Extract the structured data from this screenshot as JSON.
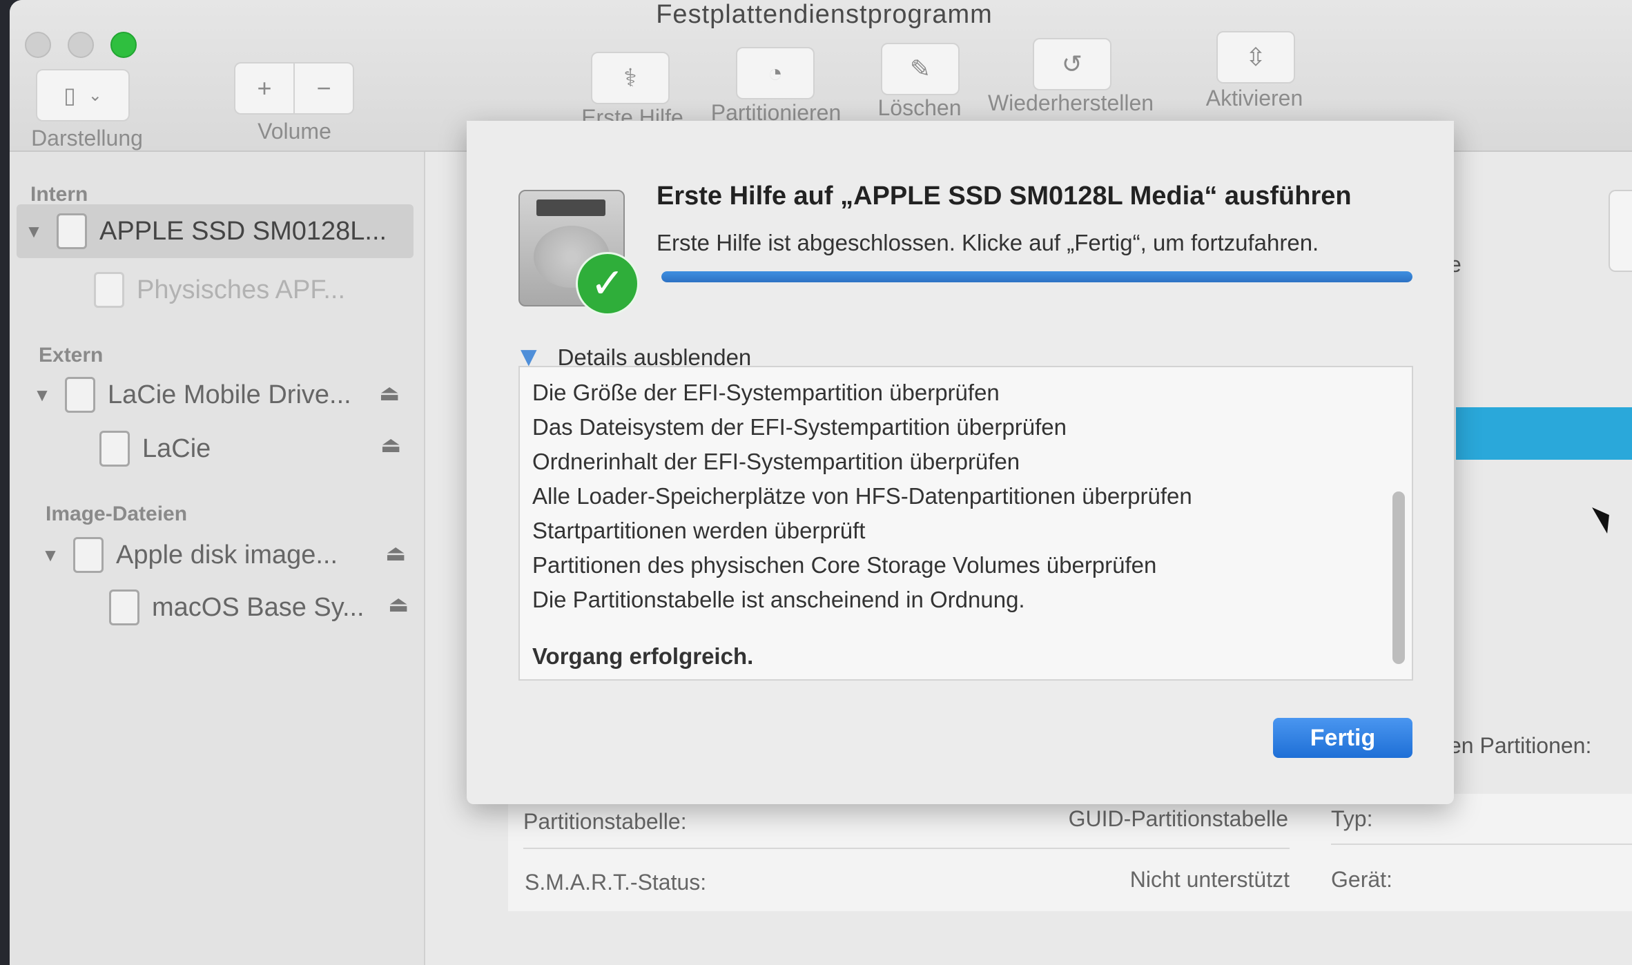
{
  "window": {
    "title": "Festplattendienstprogramm"
  },
  "toolbar": {
    "view_label": "Darstellung",
    "volume_label": "Volume",
    "add_symbol": "+",
    "remove_symbol": "−",
    "buttons": [
      {
        "label": "Erste Hilfe",
        "icon": "stethoscope-icon"
      },
      {
        "label": "Partitionieren",
        "icon": "pie-chart-icon"
      },
      {
        "label": "Löschen",
        "icon": "erase-icon"
      },
      {
        "label": "Wiederherstellen",
        "icon": "restore-icon"
      },
      {
        "label": "Aktivieren",
        "icon": "mount-icon"
      }
    ]
  },
  "sidebar": {
    "sections": [
      {
        "title": "Intern"
      },
      {
        "title": "Extern"
      },
      {
        "title": "Image-Dateien"
      }
    ],
    "items": [
      {
        "label": "APPLE SSD SM0128L...",
        "selected": true
      },
      {
        "label": "Physisches APF..."
      },
      {
        "label": "LaCie Mobile Drive..."
      },
      {
        "label": "LaCie"
      },
      {
        "label": "Apple disk image..."
      },
      {
        "label": "macOS Base Sy..."
      }
    ],
    "eject_symbol": "⏏"
  },
  "sheet": {
    "title": "Erste Hilfe auf „APPLE SSD SM0128L Media“ ausführen",
    "message": "Erste Hilfe ist abgeschlossen. Klicke auf „Fertig“, um fortzufahren.",
    "progress": 1.0,
    "details_toggle": "Details ausblenden",
    "log": [
      "Die Größe der EFI-Systempartition überprüfen",
      "Das Dateisystem der EFI-Systempartition überprüfen",
      "Ordnerinhalt der EFI-Systempartition überprüfen",
      "Alle Loader-Speicherplätze von HFS-Datenpartitionen überprüfen",
      "Startpartitionen werden überprüft",
      "Partitionen des physischen Core Storage Volumes überprüfen",
      "Die Partitionstabelle ist anscheinend in Ordnung."
    ],
    "result": "Vorgang erfolgreich.",
    "done_button": "Fertig"
  },
  "info": {
    "partition_table_label": "Partitionstabelle:",
    "partition_table_value": "GUID-Partitionstabelle",
    "smart_label": "S.M.A.R.T.-Status:",
    "smart_value": "Nicht unterstützt",
    "type_label": "Typ:",
    "device_label": "Gerät:",
    "partitions_label_partial": "en Partitionen:",
    "right_partial": "e"
  },
  "colors": {
    "accent": "#2d72c4",
    "success": "#2fae3a",
    "partition_bar": "#2aa8da"
  }
}
